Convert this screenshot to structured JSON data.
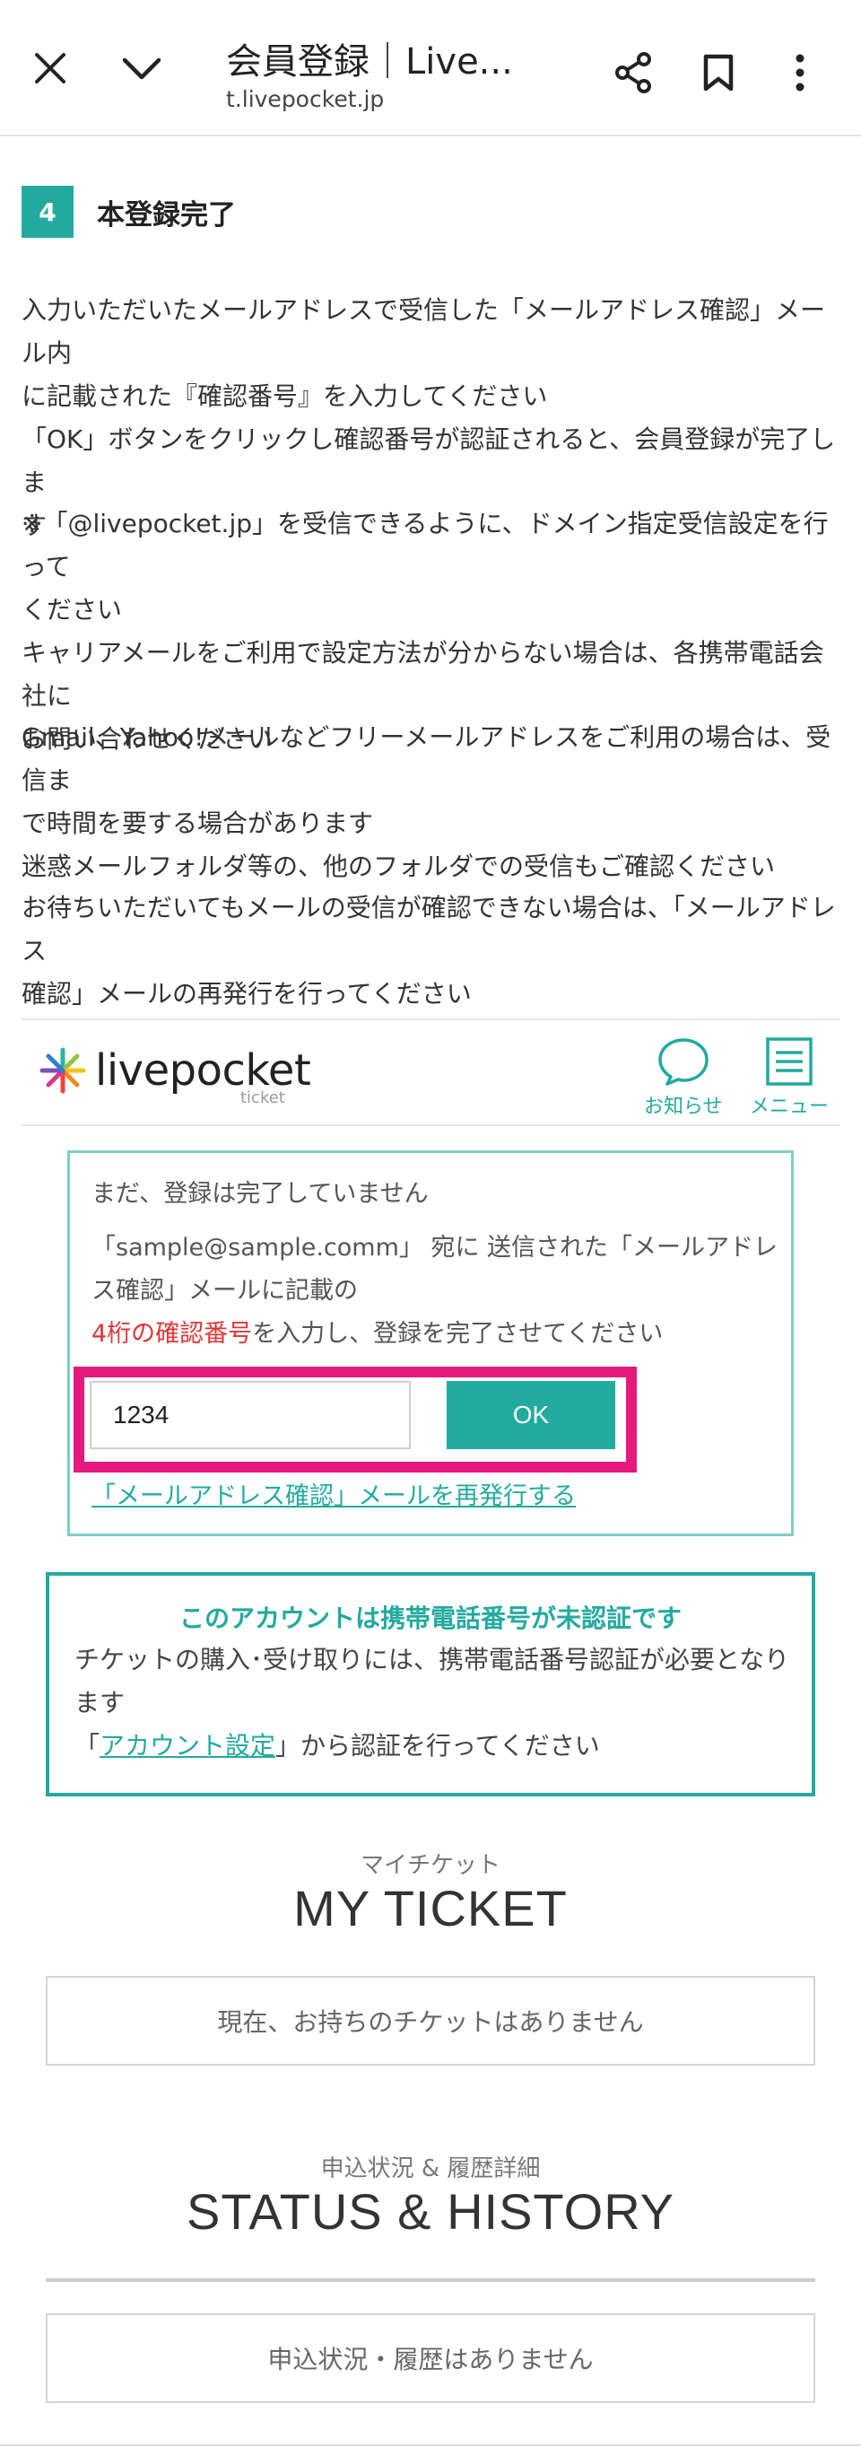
{
  "browser": {
    "title": "会員登録｜Live...",
    "host": "t.livepocket.jp",
    "icons": [
      "close-icon",
      "chevron-down-icon",
      "share-icon",
      "bookmark-icon",
      "more-vert-icon"
    ]
  },
  "step": {
    "number": "4",
    "title": "本登録完了"
  },
  "instructions": {
    "p1_line1": "入力いただいたメールアドレスで受信した「メールアドレス確認」メール内",
    "p1_line2": "に記載された『確認番号』を入力してください",
    "p1_line3": "「OK」ボタンをクリックし確認番号が認証されると、会員登録が完了しま",
    "p1_line4": "す",
    "p2_line1": "※「@livepocket.jp」を受信できるように、ドメイン指定受信設定を行って",
    "p2_line2": "ください",
    "p2_line3": "キャリアメールをご利用で設定方法が分からない場合は、各携帯電話会社に",
    "p2_line4": "お問い合わせください",
    "p3_line1": "Gmail、Yahoo!メールなどフリーメールアドレスをご利用の場合は、受信ま",
    "p3_line2": "で時間を要する場合があります",
    "p3_line3": "迷惑メールフォルダ等の、他のフォルダでの受信もご確認ください",
    "p4_line1": "お待ちいただいてもメールの受信が確認できない場合は、「メールアドレス",
    "p4_line2": "確認」メールの再発行を行ってください"
  },
  "app": {
    "logo_text": "livepocket",
    "logo_sub": "ticket",
    "notice_label": "お知らせ",
    "menu_label": "メニュー",
    "notice_box": {
      "line1": "まだ、登録は完了していません",
      "line2": "「sample@sample.comm」 宛に 送信された「メールアドレ",
      "line3": "ス確認」メールに記載の",
      "line4_red": "4桁の確認番号",
      "line4_rest": "を入力し、登録を完了させてください",
      "input_value": "1234",
      "ok_label": "OK",
      "resend_link": "「メールアドレス確認」メールを再発行する"
    },
    "phone_box": {
      "title": "このアカウントは携帯電話番号が未認証です",
      "line1": "チケットの購入･受け取りには、携帯電話番号認証が必要となり",
      "line2": "ます",
      "line3_open": "「",
      "line3_link": "アカウント設定",
      "line3_rest": "」から認証を行ってください"
    },
    "my_ticket": {
      "sub": "マイチケット",
      "title": "MY TICKET",
      "empty": "現在、お持ちのチケットはありません"
    },
    "status": {
      "sub": "申込状況 & 履歴詳細",
      "title": "STATUS & HISTORY",
      "empty": "申込状況・履歴はありません"
    }
  },
  "colors": {
    "accent": "#23aa9f",
    "highlight_frame": "#e6197d",
    "warning_text": "#e03535"
  }
}
